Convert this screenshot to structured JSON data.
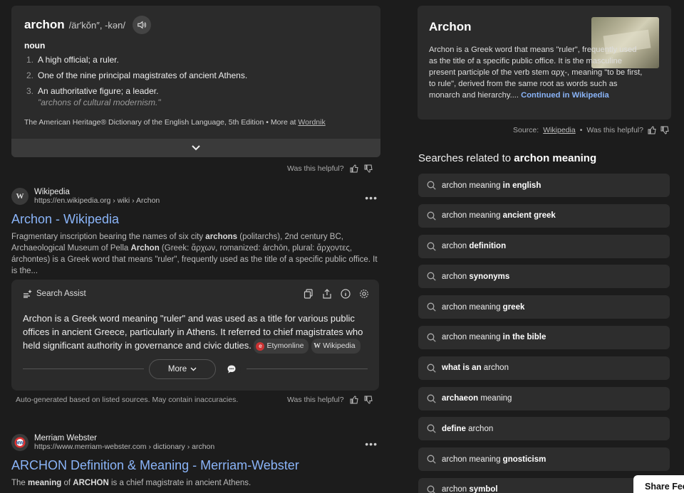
{
  "dictionary": {
    "word": "archon",
    "pronunciation": "/är′kŏn″, -kən/",
    "part_of_speech": "noun",
    "definitions": [
      {
        "num": "1.",
        "text": "A high official; a ruler."
      },
      {
        "num": "2.",
        "text": "One of the nine principal magistrates of ancient Athens."
      },
      {
        "num": "3.",
        "text": "An authoritative figure; a leader.",
        "example": "\"archons of cultural modernism.\""
      }
    ],
    "source_text": "The American Heritage® Dictionary of the English Language, 5th Edition • More at",
    "source_link": "Wordnik"
  },
  "helpful_text": "Was this helpful?",
  "results": [
    {
      "site": "Wikipedia",
      "favicon": "W",
      "url": "https://en.wikipedia.org › wiki › Archon",
      "title": "Archon - Wikipedia",
      "snippet_parts": [
        "Fragmentary inscription bearing the names of six city ",
        "archons",
        " (politarchs), 2nd century BC, Archaeological Museum of Pella ",
        "Archon",
        " (Greek: ἄρχων, romanized: árchōn, plural: ἄρχοντες, árchontes) is a Greek word that means \"ruler\", frequently used as the title of a specific public office. It is the..."
      ]
    },
    {
      "site": "Merriam Webster",
      "url": "https://www.merriam-webster.com › dictionary › archon",
      "title": "ARCHON Definition & Meaning - Merriam-Webster",
      "snippet_parts": [
        "The ",
        "meaning",
        " of ",
        "ARCHON",
        " is a chief magistrate in ancient Athens."
      ]
    }
  ],
  "assist": {
    "label": "Search Assist",
    "text": "Archon is a Greek word meaning \"ruler\" and was used as a title for various public offices in ancient Greece, particularly in Athens. It referred to chief magistrates who held significant authority in governance and civic duties.",
    "sources": [
      {
        "badge": "e",
        "name": "Etymonline"
      },
      {
        "badge": "W",
        "name": "Wikipedia"
      }
    ],
    "more_label": "More",
    "note": "Auto-generated based on listed sources. May contain inaccuracies."
  },
  "knowledge_panel": {
    "title": "Archon",
    "text": "Archon is a Greek word that means \"ruler\", frequently used as the title of a specific public office. It is the masculine present participle of the verb stem αρχ-, meaning \"to be first, to rule\", derived from the same root as words such as monarch and hierarchy....",
    "continue_label": "Continued in Wikipedia",
    "source_label": "Source:",
    "source_link": "Wikipedia"
  },
  "related": {
    "heading_prefix": "Searches related to",
    "heading_query": "archon meaning",
    "items": [
      {
        "plain": "archon meaning ",
        "bold": "in english"
      },
      {
        "plain": "archon meaning ",
        "bold": "ancient greek"
      },
      {
        "plain": "archon ",
        "bold": "definition"
      },
      {
        "plain": "archon ",
        "bold": "synonyms"
      },
      {
        "plain": "archon meaning ",
        "bold": "greek"
      },
      {
        "plain": "archon meaning ",
        "bold": "in the bible"
      },
      {
        "bold_first": "what is an",
        "plain_after": " archon"
      },
      {
        "bold_first": "archaeon",
        "plain_after": " meaning"
      },
      {
        "bold_first": "define",
        "plain_after": " archon"
      },
      {
        "plain": "archon meaning ",
        "bold": "gnosticism"
      },
      {
        "plain": "archon ",
        "bold": "symbol"
      }
    ]
  },
  "share_label": "Share Feedback"
}
